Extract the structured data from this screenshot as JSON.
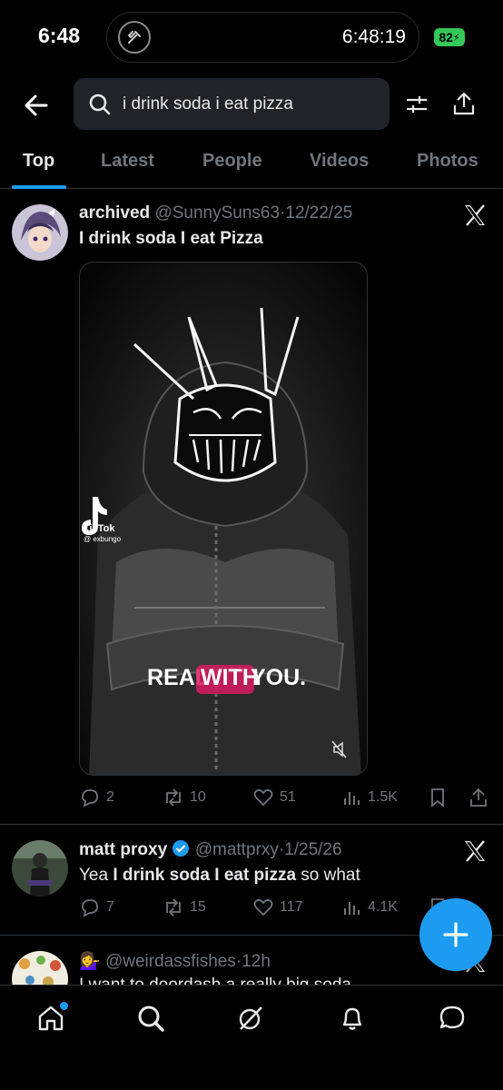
{
  "status_bar": {
    "time": "6:48",
    "live_activity_time": "6:48:19",
    "battery": "82"
  },
  "search": {
    "query": "i drink soda i eat pizza"
  },
  "tabs": [
    {
      "label": "Top",
      "active": true
    },
    {
      "label": "Latest",
      "active": false
    },
    {
      "label": "People",
      "active": false
    },
    {
      "label": "Videos",
      "active": false
    },
    {
      "label": "Photos",
      "active": false
    }
  ],
  "tweets": [
    {
      "name": "archived",
      "handle": "@SunnySuns63",
      "date": "12/22/25",
      "text": "I drink soda I eat Pizza",
      "media": {
        "watermark_brand": "TikTok",
        "watermark_user": "@ exbungo",
        "caption_before": "REAL ",
        "caption_highlight": "WITH",
        "caption_after": " YOU."
      },
      "replies": "2",
      "reposts": "10",
      "likes": "51",
      "views": "1.5K"
    },
    {
      "name": "matt proxy",
      "verified": true,
      "handle": "@mattprxy",
      "date": "1/25/26",
      "text_prefix": "Yea ",
      "text_bold": "I drink soda I eat pizza",
      "text_suffix": " so what",
      "replies": "7",
      "reposts": "15",
      "likes": "117",
      "views": "4.1K"
    },
    {
      "name": "💁‍♀️",
      "handle": "@weirdassfishes",
      "date": "12h",
      "text": "I want to doordash a really big soda"
    }
  ],
  "colors": {
    "accent": "#1d9bf0",
    "background": "#000000",
    "text": "#e7e9ea",
    "muted": "#71767b",
    "battery": "#34c759",
    "caption_highlight": "#d81b60"
  },
  "icons": {
    "nav": [
      "home-icon",
      "search-icon",
      "grok-icon",
      "notifications-icon",
      "messages-icon"
    ],
    "fab": "plus-icon"
  }
}
